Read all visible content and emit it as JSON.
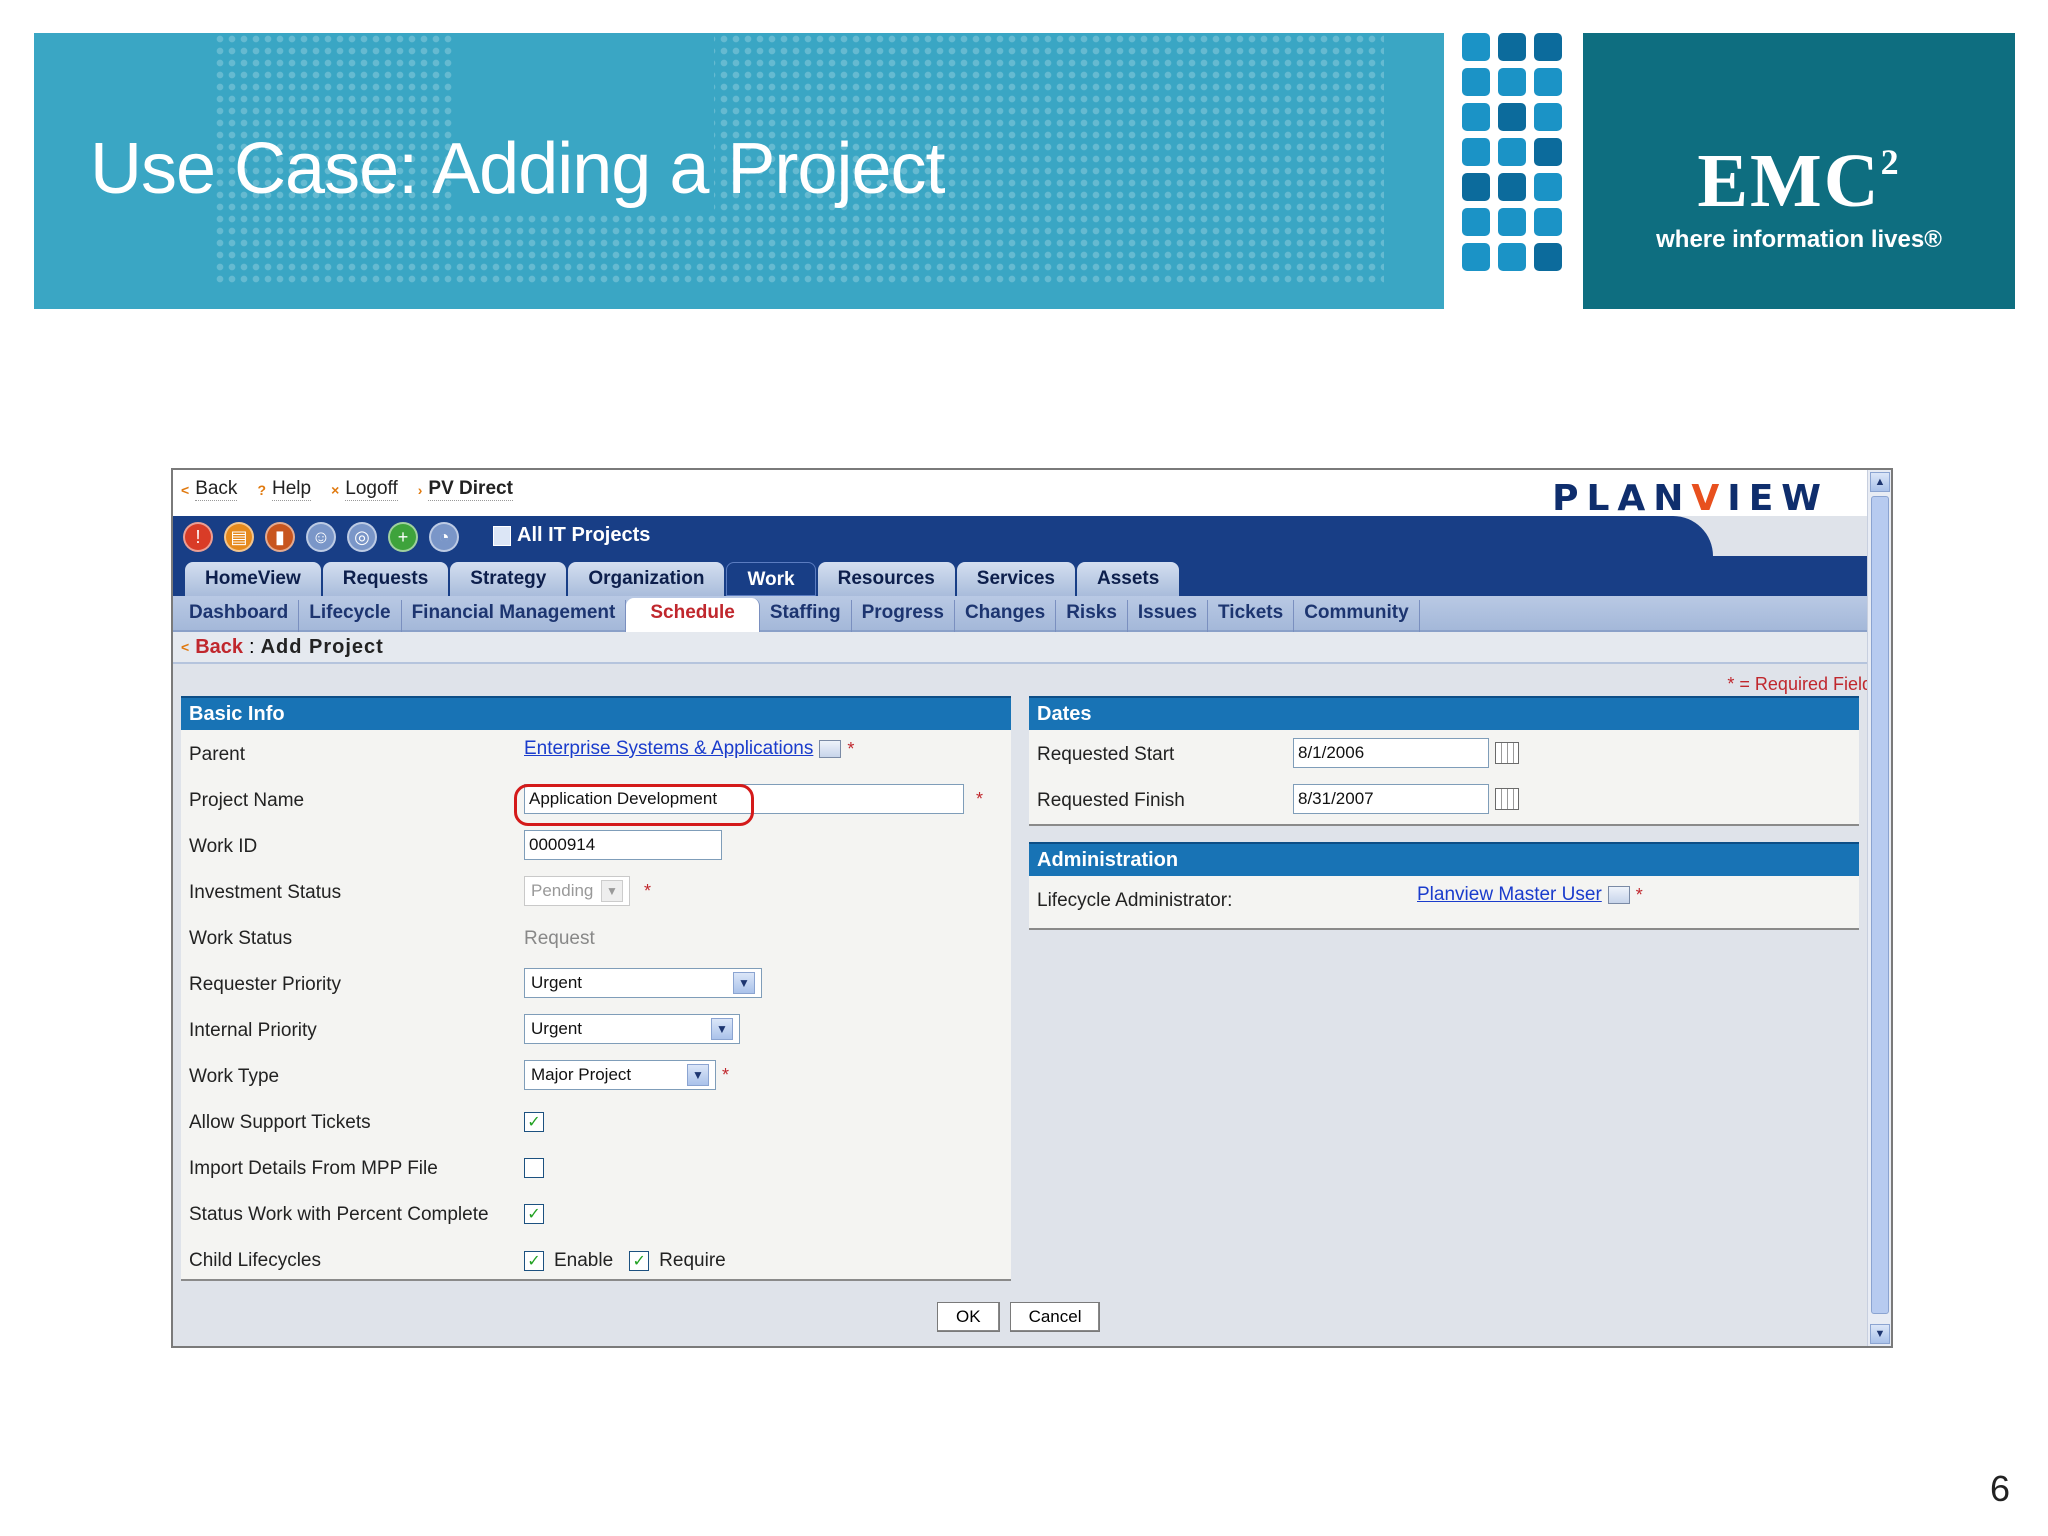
{
  "slide": {
    "title": "Use Case: Adding a Project",
    "brand": {
      "logo": "EMC",
      "superscript": "2",
      "tagline": "where information lives®"
    },
    "page_number": "6"
  },
  "app": {
    "top_links": [
      {
        "label": "Back",
        "icon": "back-arrow-icon"
      },
      {
        "label": "Help",
        "icon": "help-icon"
      },
      {
        "label": "Logoff",
        "icon": "logoff-icon"
      },
      {
        "label": "PV Direct",
        "icon": "pv-direct-icon"
      }
    ],
    "logo_text_a": "PLAN",
    "logo_text_v": "V",
    "logo_text_b": "IEW",
    "toolbar_title": "All IT Projects",
    "tabs_primary": [
      "HomeView",
      "Requests",
      "Strategy",
      "Organization",
      "Work",
      "Resources",
      "Services",
      "Assets"
    ],
    "active_primary": "Work",
    "tabs_secondary": [
      "Dashboard",
      "Lifecycle",
      "Financial Management",
      "Schedule",
      "Staffing",
      "Progress",
      "Changes",
      "Risks",
      "Issues",
      "Tickets",
      "Community"
    ],
    "active_secondary": "Schedule",
    "crumb_back": "Back",
    "crumb_sep": ":",
    "crumb_title": "Add Project",
    "required_note": "* = Required Fields",
    "basic_info": {
      "header": "Basic Info",
      "parent_label": "Parent",
      "parent_value": "Enterprise Systems & Applications",
      "project_name_label": "Project Name",
      "project_name_value": "Application Development",
      "work_id_label": "Work ID",
      "work_id_value": "0000914",
      "investment_status_label": "Investment Status",
      "investment_status_value": "Pending",
      "work_status_label": "Work Status",
      "work_status_value": "Request",
      "requester_priority_label": "Requester Priority",
      "requester_priority_value": "Urgent",
      "internal_priority_label": "Internal Priority",
      "internal_priority_value": "Urgent",
      "work_type_label": "Work Type",
      "work_type_value": "Major Project",
      "allow_support_tickets_label": "Allow Support Tickets",
      "allow_support_tickets_checked": true,
      "import_mpp_label": "Import Details From MPP File",
      "import_mpp_checked": false,
      "status_work_label": "Status Work with Percent Complete",
      "status_work_checked": true,
      "child_lifecycles_label": "Child Lifecycles",
      "enable_label": "Enable",
      "enable_checked": true,
      "require_label": "Require",
      "require_checked": true
    },
    "dates": {
      "header": "Dates",
      "requested_start_label": "Requested Start",
      "requested_start_value": "8/1/2006",
      "requested_finish_label": "Requested Finish",
      "requested_finish_value": "8/31/2007"
    },
    "administration": {
      "header": "Administration",
      "lifecycle_admin_label": "Lifecycle Administrator:",
      "lifecycle_admin_value": "Planview Master User"
    },
    "buttons": {
      "ok": "OK",
      "cancel": "Cancel"
    },
    "required_star": "*"
  }
}
